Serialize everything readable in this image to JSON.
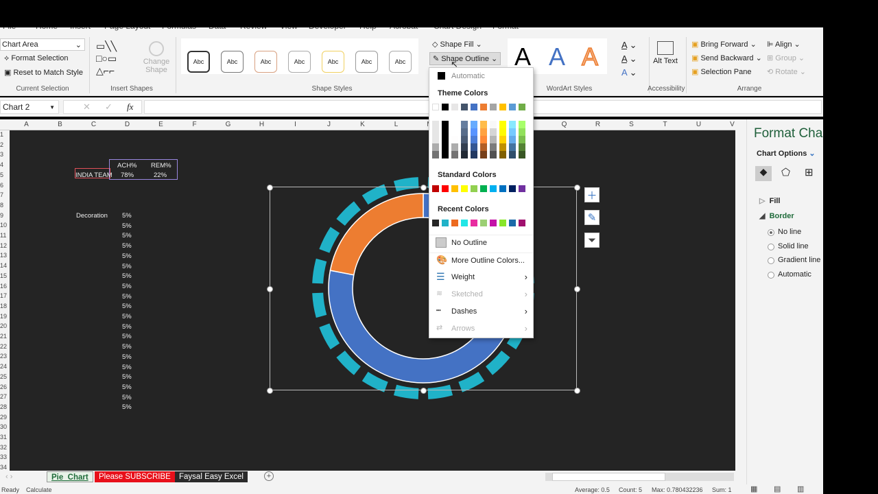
{
  "ribbon_tabs": [
    "File",
    "Home",
    "Insert",
    "Page Layout",
    "Formulas",
    "Data",
    "Review",
    "View",
    "Developer",
    "Help",
    "Acrobat",
    "Chart Design",
    "Format"
  ],
  "current_selection": {
    "dropdown": "Chart Area",
    "format_selection": "Format Selection",
    "reset": "Reset to Match Style",
    "group": "Current Selection"
  },
  "insert_shapes": {
    "change_shape": "Change Shape",
    "group": "Insert Shapes"
  },
  "shape_styles": {
    "sample": "Abc",
    "count": 7,
    "group": "Shape Styles",
    "shape_fill": "Shape Fill",
    "shape_outline": "Shape Outline"
  },
  "wordart": {
    "letter": "A",
    "group": "WordArt Styles"
  },
  "accessibility": {
    "alt_text": "Alt Text",
    "group": "Accessibility"
  },
  "arrange": {
    "bring_forward": "Bring Forward",
    "send_backward": "Send Backward",
    "selection_pane": "Selection Pane",
    "align": "Align",
    "group_btn": "Group",
    "rotate": "Rotate",
    "group": "Arrange"
  },
  "formula_bar": {
    "name_box": "Chart 2",
    "fx": "fx",
    "value": ""
  },
  "columns": [
    "A",
    "B",
    "C",
    "D",
    "E",
    "F",
    "G",
    "H",
    "I",
    "J",
    "K",
    "L",
    "M",
    "N",
    "O",
    "P",
    "Q",
    "R",
    "S",
    "T",
    "U",
    "V"
  ],
  "rows": 34,
  "cells": {
    "header": [
      "ACH%",
      "REM%"
    ],
    "team": "INDIA TEAM",
    "ach": "78%",
    "rem": "22%",
    "decoration_label": "Decoration",
    "decoration_values": [
      "5%",
      "5%",
      "5%",
      "5%",
      "5%",
      "5%",
      "5%",
      "5%",
      "5%",
      "5%",
      "5%",
      "5%",
      "5%",
      "5%",
      "5%",
      "5%",
      "5%",
      "5%",
      "5%",
      "5%"
    ]
  },
  "chart_data": {
    "type": "doughnut",
    "inner_ring": {
      "series": [
        {
          "name": "ACH%",
          "value": 78,
          "color": "#4472c4"
        },
        {
          "name": "REM%",
          "value": 22,
          "color": "#ed7d31"
        }
      ]
    },
    "outer_ring": {
      "name": "Decoration",
      "values": [
        5,
        5,
        5,
        5,
        5,
        5,
        5,
        5,
        5,
        5,
        5,
        5,
        5,
        5,
        5,
        5,
        5,
        5,
        5,
        5
      ],
      "color": "#20b2c8"
    }
  },
  "outline_menu": {
    "automatic": "Automatic",
    "theme_colors_title": "Theme Colors",
    "theme_colors": [
      "#ffffff",
      "#000000",
      "#e7e6e6",
      "#44546a",
      "#4472c4",
      "#ed7d31",
      "#a5a5a5",
      "#ffc000",
      "#5b9bd5",
      "#70ad47"
    ],
    "standard_colors_title": "Standard Colors",
    "standard_colors": [
      "#c00000",
      "#ff0000",
      "#ffc000",
      "#ffff00",
      "#92d050",
      "#00b050",
      "#00b0f0",
      "#0070c0",
      "#002060",
      "#7030a0"
    ],
    "recent_colors_title": "Recent Colors",
    "recent_colors": [
      "#262626",
      "#20b2c8",
      "#ed6a1f",
      "#22e6e6",
      "#e82ca0",
      "#9ccf74",
      "#c412a8",
      "#88e62a",
      "#1b6aa8",
      "#a0106e"
    ],
    "no_outline": "No Outline",
    "more_colors": "More Outline Colors...",
    "weight": "Weight",
    "sketched": "Sketched",
    "dashes": "Dashes",
    "arrows": "Arrows"
  },
  "format_pane": {
    "title": "Format Chart Area",
    "options": "Chart Options",
    "fill": "Fill",
    "border": "Border",
    "border_options": [
      "No line",
      "Solid line",
      "Gradient line",
      "Automatic"
    ],
    "selected": "No line"
  },
  "sheets": [
    {
      "name": "Pie_Chart",
      "active": true,
      "color": "#e8f2e8"
    },
    {
      "name": "Please SUBSCRIBE",
      "color": "#e8101a"
    },
    {
      "name": "Faysal Easy Excel",
      "color": "#2a2a2a"
    }
  ],
  "status": {
    "ready": "Ready",
    "calculate": "Calculate",
    "average": "Average: 0.5",
    "count": "Count: 5",
    "max": "Max: 0.780432236",
    "sum": "Sum: 1"
  }
}
